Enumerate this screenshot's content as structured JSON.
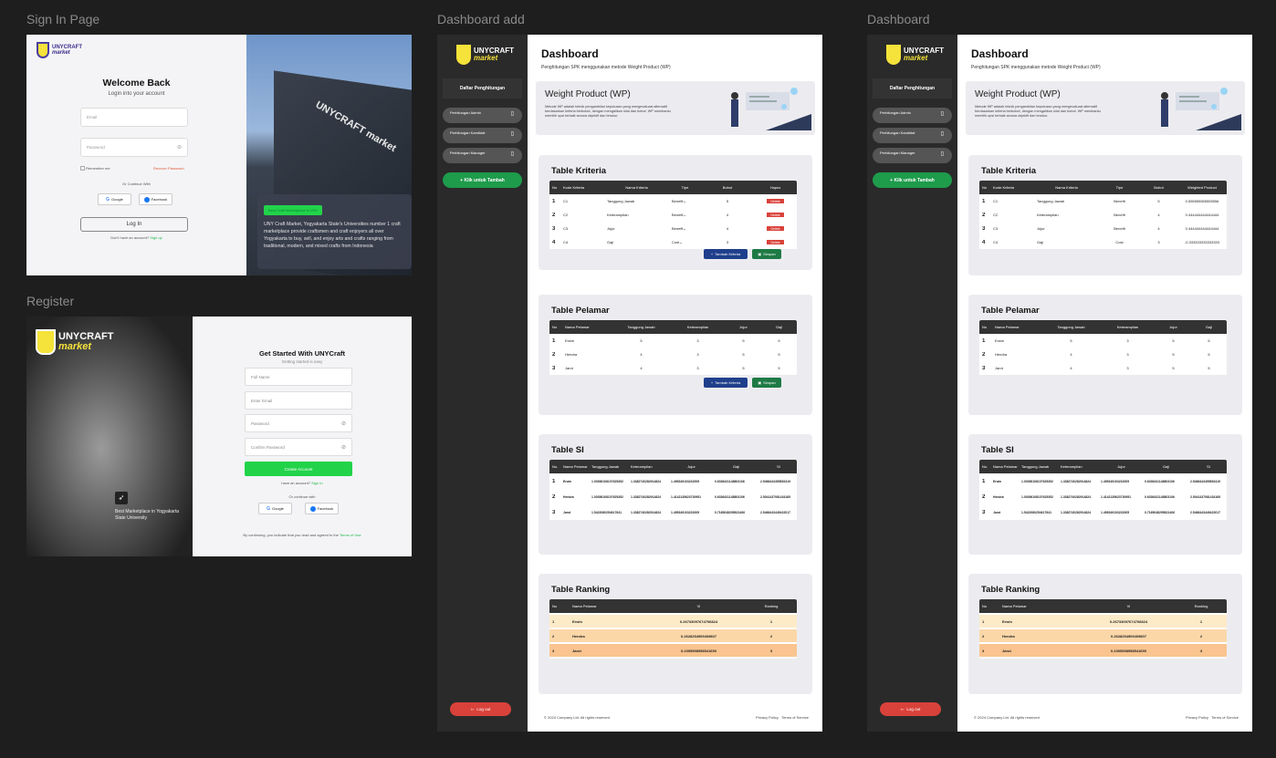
{
  "labels": {
    "signin": "Sign In Page",
    "register": "Register",
    "dash_add": "Dashboard add",
    "dash_view": "Dashboard"
  },
  "brand": {
    "line1": "UNYCRAFT",
    "line2": "market"
  },
  "signin": {
    "title": "Welcome Back",
    "subtitle": "Login into your account",
    "email_placeholder": "Email",
    "password_placeholder": "Password",
    "remember": "Remember me",
    "recover": "Recover Password",
    "or": "Or Continue With",
    "google": "Google",
    "facebook": "Facebook",
    "login": "Log In",
    "no_account": "Don't have an account?",
    "signup": "Sign up",
    "card_chip": "Best Craft Marketplace in UNY",
    "card_text": "UNY Craft Market, Yogyakarta State's Universities number 1 craft marketplace provide craftsmen and craft enjoyers all over Yogyakarta to buy, sell, and enjoy arts and crafts ranging from traditional, modern, and mixed crafts from Indonesia",
    "building_text": "UNYCRAFT market"
  },
  "register": {
    "title": "Get Started With UNYCraft",
    "subtitle": "Getting started is easy",
    "fullname": "Full Name",
    "email": "Enter Email",
    "password": "Password",
    "confirm": "Confirm Password",
    "create": "Create Account",
    "have_account": "have an account?",
    "signin": "Sign In",
    "or": "Or continue with",
    "google": "Google",
    "facebook": "Facebook",
    "terms_prefix": "By continuing, you indicate that you read and agreed to the",
    "terms_link": "Terms of Use",
    "badge_text": "Best Marketplace in Yogyakarta State University"
  },
  "sidebar": {
    "head": "Daftar Penghitungan",
    "items": [
      "Perhitungan Admin",
      "Perhitungan Kandidat",
      "Perhitungan Manager"
    ],
    "add": "Klik untuk Tambah",
    "logout": "Log out"
  },
  "main": {
    "title": "Dashboard",
    "subtitle": "Penghitungan SPK menggunakan metode Weight Product (WP)",
    "wp_title": "Weight Product (WP)",
    "wp_desc": "Metode WP adalah teknik pengambilan keputusan yang mengevaluasi alternatif berdasarkan kriteria berbobot, dengan mengalikan nilai dan bobot. WP membantu memilih opsi terbaik secara objektif dan terukur."
  },
  "kriteria": {
    "title": "Table Kriteria",
    "headers_add": [
      "No",
      "Kode Kriteria",
      "Nama Kriteria",
      "Tipe",
      "Bobot",
      "Hapus"
    ],
    "headers_view": [
      "No",
      "Kode Kriteria",
      "Nama Kriteria",
      "Tipe",
      "Bobot",
      "Weighted Product"
    ],
    "rows": [
      {
        "no": "1",
        "kode": "C1",
        "nama": "Tanggung Jawab",
        "tipe": "Benefit",
        "bobot": "5",
        "wp": "0.555555555555556"
      },
      {
        "no": "2",
        "kode": "C2",
        "nama": "Keterampilan",
        "tipe": "Benefit",
        "bobot": "4",
        "wp": "0.444444444444444"
      },
      {
        "no": "3",
        "kode": "C3",
        "nama": "Jujur",
        "tipe": "Benefit",
        "bobot": "4",
        "wp": "0.444444444444444"
      },
      {
        "no": "4",
        "kode": "C4",
        "nama": "Gaji",
        "tipe": "Cost",
        "bobot": "3",
        "wp": "-0.333333333333333"
      }
    ],
    "hapus": "Delete",
    "tambah": "Tambah Kriteria",
    "simpan": "Simpan"
  },
  "pelamar": {
    "title": "Table Pelamar",
    "headers": [
      "No",
      "Nama Pelamar",
      "Tanggung Jawab",
      "Keterampilan",
      "Jujur",
      "Gaji"
    ],
    "rows": [
      {
        "no": "1",
        "nama": "Erwin",
        "tj": "5",
        "kt": "3",
        "jj": "5",
        "gj": "5"
      },
      {
        "no": "2",
        "nama": "Hendra",
        "tj": "4",
        "kt": "3",
        "jj": "5",
        "gj": "5"
      },
      {
        "no": "3",
        "nama": "Jarot",
        "tj": "4",
        "kt": "3",
        "jj": "5",
        "gj": "5"
      }
    ],
    "tambah": "Tambah Kriteria",
    "simpan": "Simpan"
  },
  "si": {
    "title": "Table SI",
    "headers": [
      "No.",
      "Nama Pelamar",
      "Tanggung Jawab",
      "Keterampilan",
      "Jujur",
      "Gaji",
      "SI"
    ],
    "rows": [
      {
        "no": "1",
        "nama": "Erwin",
        "tj": "1.00356108107625352",
        "kt": "1.3382740282914824",
        "jj": "1.495349103232005",
        "gj": "0.6336431148803106",
        "si": "2.5466443459852419"
      },
      {
        "no": "2",
        "nama": "Hendra",
        "tj": "1.00356108107625352",
        "kt": "1.3382740282914824",
        "jj": "1.4142135623730951",
        "gj": "0.6336431148803106",
        "si": "2.5041437081434165"
      },
      {
        "no": "3",
        "nama": "Jarot",
        "tj": "1.5422080254617641",
        "kt": "1.3382740282914824",
        "jj": "1.495349103232005",
        "gj": "0.7165048295821406",
        "si": "2.5466443449422017"
      }
    ]
  },
  "ranking": {
    "title": "Table Ranking",
    "headers": [
      "No",
      "Nama Pelamar",
      "VI",
      "Ranking"
    ],
    "rows": [
      {
        "no": "1",
        "nama": "Erwin",
        "vi": "0.26733097674706824",
        "rank": "1"
      },
      {
        "no": "2",
        "nama": "Hendra",
        "vi": "0.2628254909409807",
        "rank": "2"
      },
      {
        "no": "3",
        "nama": "Jarot",
        "vi": "0.2305598958541690",
        "rank": "3"
      }
    ],
    "colors": [
      "#fdebc8",
      "#fbd7a8",
      "#f9c48f"
    ]
  },
  "footer": {
    "copy": "© 2024 Company Ltd. All rights reserved",
    "privacy": "Privacy Policy",
    "terms": "Terms of Service"
  }
}
